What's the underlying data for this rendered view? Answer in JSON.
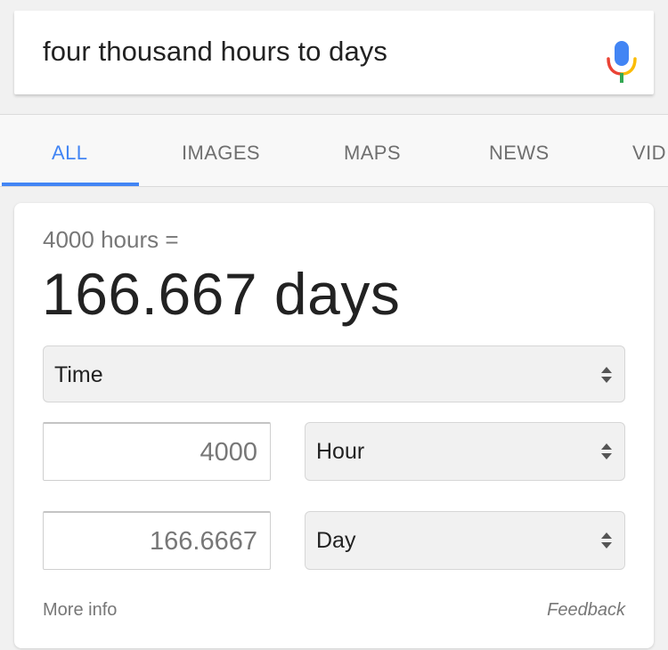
{
  "search": {
    "query": "four thousand hours to days"
  },
  "tabs": [
    {
      "label": "ALL",
      "active": true
    },
    {
      "label": "IMAGES",
      "active": false
    },
    {
      "label": "MAPS",
      "active": false
    },
    {
      "label": "NEWS",
      "active": false
    },
    {
      "label": "VID",
      "active": false
    }
  ],
  "converter": {
    "equation": "4000 hours =",
    "result": "166.667 days",
    "category": "Time",
    "from_value": "4000",
    "from_unit": "Hour",
    "to_value": "166.6667",
    "to_unit": "Day",
    "more_info": "More info",
    "feedback": "Feedback"
  },
  "icons": {
    "mic": "microphone-icon",
    "select_arrows": "up-down-arrows-icon"
  },
  "colors": {
    "accent": "#4285f4",
    "mic_blue": "#4285f4",
    "mic_red": "#ea4335",
    "mic_yellow": "#fbbc05",
    "mic_green": "#34a853"
  }
}
